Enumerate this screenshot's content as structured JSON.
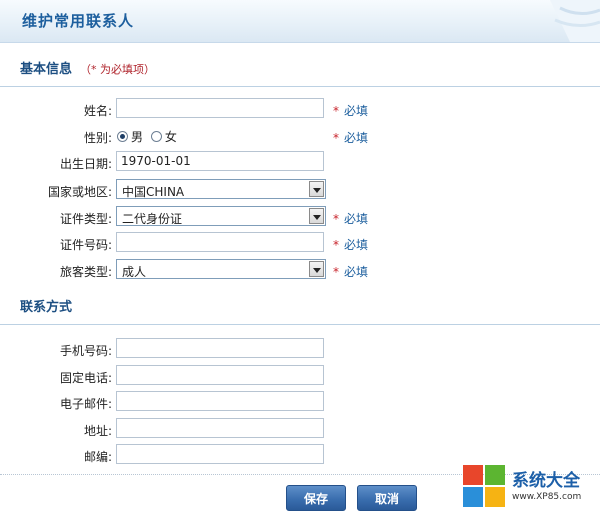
{
  "header": {
    "title": "维护常用联系人"
  },
  "basic_section": {
    "title": "基本信息",
    "note": "（* 为必填项）"
  },
  "contact_section": {
    "title": "联系方式"
  },
  "required": {
    "star": "*",
    "text": "必填"
  },
  "fields": {
    "name": {
      "label": "姓名:",
      "value": ""
    },
    "gender": {
      "label": "性别:",
      "options": [
        "男",
        "女"
      ],
      "selected": "男"
    },
    "birth": {
      "label": "出生日期:",
      "value": "1970-01-01"
    },
    "country": {
      "label": "国家或地区:",
      "value": "中国CHINA"
    },
    "id_type": {
      "label": "证件类型:",
      "value": "二代身份证"
    },
    "id_number": {
      "label": "证件号码:",
      "value": ""
    },
    "passenger_type": {
      "label": "旅客类型:",
      "value": "成人"
    },
    "mobile": {
      "label": "手机号码:",
      "value": ""
    },
    "phone": {
      "label": "固定电话:",
      "value": ""
    },
    "email": {
      "label": "电子邮件:",
      "value": ""
    },
    "address": {
      "label": "地址:",
      "value": ""
    },
    "postcode": {
      "label": "邮编:",
      "value": ""
    }
  },
  "buttons": {
    "save": "保存",
    "cancel": "取消"
  },
  "watermark": {
    "title": "系统大全",
    "url": "www.XP85.com"
  },
  "colors": {
    "accent": "#1d5f9e",
    "required": "#c8232b",
    "button": "#3a6eaf"
  }
}
